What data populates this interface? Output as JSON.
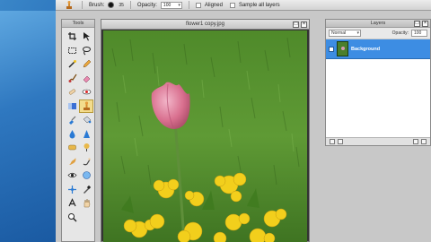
{
  "options_bar": {
    "tool_preset_icon": "stamp-icon",
    "brush_label": "Brush:",
    "brush_size": "35",
    "opacity_label": "Opacity:",
    "opacity_value": "100",
    "aligned_label": "Aligned",
    "sample_all_label": "Sample all layers"
  },
  "tools_panel": {
    "title": "Tools",
    "tools": [
      "crop-icon",
      "move-icon",
      "marquee-icon",
      "lasso-icon",
      "wand-icon",
      "pencil-icon",
      "brush-icon",
      "eraser-icon",
      "heal-icon",
      "red-eye-icon",
      "gradient-icon",
      "stamp-icon",
      "replace-color-icon",
      "bucket-icon",
      "drop-icon",
      "sharpen-icon",
      "sponge-icon",
      "dodge-icon",
      "burn-icon",
      "smudge-icon",
      "eye-icon",
      "bloat-icon",
      "pinch-icon",
      "eyedropper-icon",
      "text-icon",
      "hand-icon",
      "zoom-icon"
    ],
    "active_tool": "stamp-icon"
  },
  "image_window": {
    "title": "flower1 copy.jpg",
    "max_btn": "□",
    "close_btn": "×"
  },
  "layers_panel": {
    "title": "Layers",
    "blend_mode": "Normal",
    "opacity_label": "Opacity:",
    "opacity_value": "100",
    "layers": [
      {
        "name": "Background",
        "selected": true
      }
    ],
    "max_btn": "□",
    "close_btn": "×"
  },
  "colors": {
    "accent": "#3d8de3",
    "active_tool": "#f3dc8c"
  }
}
